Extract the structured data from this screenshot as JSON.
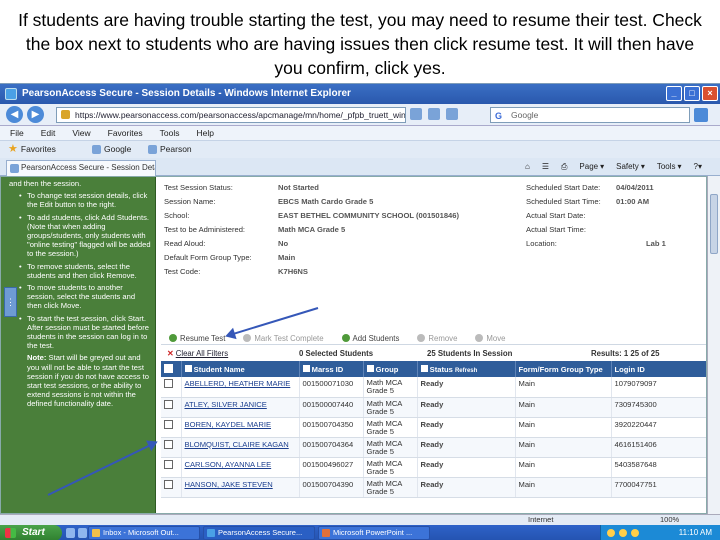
{
  "caption": "If students are having trouble starting the test, you may need to resume their test.  Check the box next to students who are having issues then click resume test.  It will then have you confirm, click yes.",
  "window": {
    "title": "PearsonAccess Secure - Session Details - Windows Internet Explorer",
    "url": "https://www.pearsonaccess.com/pearsonaccess/apcmanage/mn/home/_pfpb_truett_window.aba",
    "search_placeholder": "Google",
    "buttons": {
      "minimize": "_",
      "maximize": "□",
      "close": "×"
    }
  },
  "menu": [
    "File",
    "Edit",
    "View",
    "Favorites",
    "Tools",
    "Help"
  ],
  "favorites": {
    "label": "Favorites",
    "links": [
      "Google",
      "Pearson"
    ]
  },
  "tab": {
    "label": "PearsonAccess Secure - Session Details"
  },
  "commands": [
    "Page",
    "Safety",
    "Tools"
  ],
  "help": {
    "intro": "and then the session.",
    "items": [
      "To change test session details, click the Edit button to the right.",
      "To add students, click Add Students. (Note that when adding groups/students, only students with \"online testing\" flagged will be added to the session.)",
      "To remove students, select the students and then click Remove.",
      "To move students to another session, select the students and then click Move.",
      "To start the test session, click Start. After session must be started before students in the session can log in to the test."
    ],
    "note_label": "Note:",
    "note": "Start will be greyed out and you will not be able to start the test session if you do not have access to start test sessions, or the ability to extend sessions is not within the defined functionality date."
  },
  "details": {
    "left": [
      {
        "label": "Test Session Status:",
        "value": "Not Started"
      },
      {
        "label": "Session Name:",
        "value": "EBCS Math Cardo Grade 5"
      },
      {
        "label": "School:",
        "value": "EAST BETHEL COMMUNITY SCHOOL (001501846)"
      },
      {
        "label": "Test to be Administered:",
        "value": "Math MCA Grade 5"
      },
      {
        "label": "Read Aloud:",
        "value": "No"
      },
      {
        "label": "Default Form Group Type:",
        "value": "Main"
      },
      {
        "label": "Test Code:",
        "value": "K7H6NS"
      }
    ],
    "right": [
      {
        "label": "Scheduled Start Date:",
        "value": "04/04/2011"
      },
      {
        "label": "Scheduled Start Time:",
        "value": "01:00 AM"
      },
      {
        "label": "Actual Start Date:",
        "value": ""
      },
      {
        "label": "Actual Start Time:",
        "value": ""
      },
      {
        "label": "Location:",
        "value": "Lab 1"
      }
    ]
  },
  "toolbar": {
    "resume": "Resume Test",
    "mark": "Mark Test Complete",
    "add": "Add Students",
    "remove": "Remove",
    "move": "Move"
  },
  "results": {
    "clear_filters": "Clear All Filters",
    "selected": "0 Selected Students",
    "in_session": "25 Students In Session",
    "range": "Results: 1 25 of 25"
  },
  "table": {
    "headers": [
      "Student Name",
      "Marss ID",
      "Group",
      "Status",
      "Form/Form Group Type",
      "Login ID"
    ],
    "refresh": "Refresh",
    "rows": [
      {
        "name": "ABELLERD, HEATHER MARIE",
        "id": "001500071030",
        "group": "Math MCA Grade 5",
        "status": "Ready",
        "form": "Main",
        "login": "1079079097"
      },
      {
        "name": "ATLEY, SILVER JANICE",
        "id": "001500007440",
        "group": "Math MCA Grade 5",
        "status": "Ready",
        "form": "Main",
        "login": "7309745300"
      },
      {
        "name": "BOREN, KAYDEL MARIE",
        "id": "001500704350",
        "group": "Math MCA Grade 5",
        "status": "Ready",
        "form": "Main",
        "login": "3920220447"
      },
      {
        "name": "BLOMQUIST, CLAIRE KAGAN",
        "id": "001500704364",
        "group": "Math MCA Grade 5",
        "status": "Ready",
        "form": "Main",
        "login": "4616151406"
      },
      {
        "name": "CARLSON, AYANNA LEE",
        "id": "001500496027",
        "group": "Math MCA Grade 5",
        "status": "Ready",
        "form": "Main",
        "login": "5403587648"
      },
      {
        "name": "HANSON, JAKE STEVEN",
        "id": "001500704390",
        "group": "Math MCA Grade 5",
        "status": "Ready",
        "form": "Main",
        "login": "7700047751"
      }
    ]
  },
  "statusbar": {
    "zone": "Internet",
    "zoom": "100%"
  },
  "taskbar": {
    "start": "Start",
    "tasks": [
      "Inbox - Microsoft Out...",
      "PearsonAccess Secure...",
      "Microsoft PowerPoint ..."
    ],
    "clock": "11:10 AM"
  },
  "colors": {
    "header_blue": "#2f5d9a",
    "help_green": "#4a7f3a",
    "arrow_blue": "#3557b8"
  }
}
